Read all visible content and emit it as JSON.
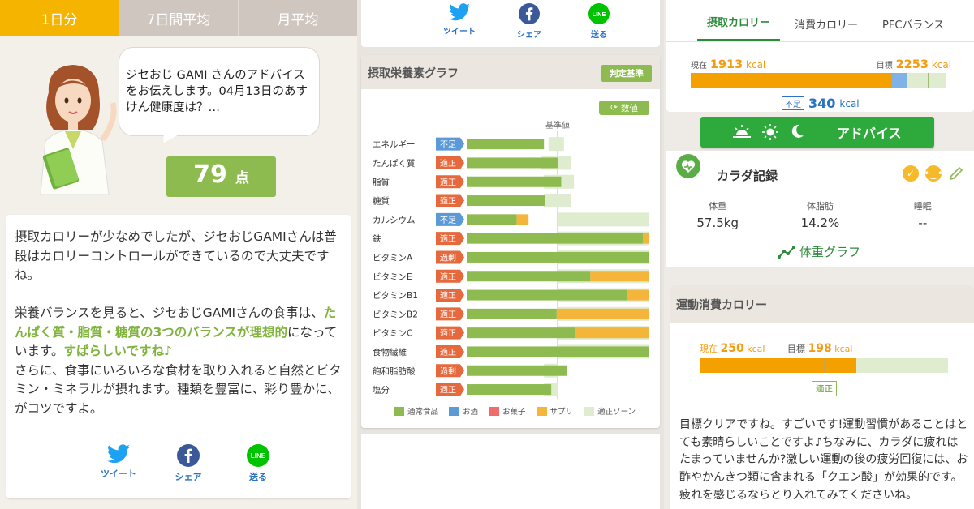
{
  "period_tabs": [
    "1日分",
    "7日間平均",
    "月平均"
  ],
  "bubble_text": "ジセおじ GAMI さんのアドバイスをお伝えします。04月13日のあすけん健康度は？…",
  "score": {
    "value": "79",
    "unit": "点"
  },
  "advice": {
    "p1": "摂取カロリーが少なめでしたが、ジセおじGAMIさんは普段はカロリーコントロールができているので大丈夫ですね。",
    "p2a": "栄養バランスを見ると、ジセおじGAMIさんの食事は、",
    "p2b": "たんぱく質・脂質・糖質の3つのバランスが理想的",
    "p2c": "になっています。",
    "p2d": "すばらしいですね♪",
    "p2e": "さらに、食事にいろいろな食材を取り入れると自然とビタミン・ミネラルが摂れます。種類を豊富に、彩り豊かに、がコツですよ。"
  },
  "share": {
    "tweet": "ツイート",
    "share": "シェア",
    "line": "送る",
    "line_logo": "LINE"
  },
  "nutrition": {
    "title": "摂取栄養素グラフ",
    "criteria_label": "判定基準",
    "value_toggle": "数値",
    "baseline_label": "基準値",
    "legend": [
      {
        "label": "通常食品",
        "color": "#8dbb4f"
      },
      {
        "label": "お酒",
        "color": "#5b9ad6"
      },
      {
        "label": "お菓子",
        "color": "#f06b6b"
      },
      {
        "label": "サプリ",
        "color": "#f5b43a"
      },
      {
        "label": "適正ゾーン",
        "color": "#dfeccf"
      }
    ]
  },
  "chart_data": {
    "type": "bar",
    "categories": [
      "エネルギー",
      "たんぱく質",
      "脂質",
      "糖質",
      "カルシウム",
      "鉄",
      "ビタミンA",
      "ビタミンE",
      "ビタミンB1",
      "ビタミンB2",
      "ビタミンC",
      "食物繊維",
      "飽和脂肪酸",
      "塩分"
    ],
    "judgement": [
      "不足",
      "適正",
      "適正",
      "適正",
      "不足",
      "適正",
      "過剰",
      "適正",
      "適正",
      "適正",
      "適正",
      "適正",
      "過剰",
      "適正"
    ],
    "judgement_colors": {
      "不足": "#5b9ad6",
      "適正": "#e6693e",
      "過剰": "#e6693e"
    },
    "series": [
      {
        "name": "通常食品",
        "values": [
          0.85,
          1.0,
          1.04,
          0.86,
          0.55,
          1.94,
          2.0,
          1.36,
          1.76,
          0.99,
          1.19,
          2.0,
          1.1,
          0.93
        ]
      },
      {
        "name": "サプリ",
        "values": [
          0,
          0,
          0,
          0,
          0.13,
          0.06,
          0,
          0.64,
          0.24,
          1.01,
          0.81,
          0,
          0,
          0
        ]
      }
    ],
    "zone_start": [
      0.9,
      0.82,
      0.85,
      0.85,
      1.0,
      1.0,
      1.0,
      1.0,
      1.0,
      1.0,
      1.0,
      1.0,
      0.85,
      0.85
    ],
    "zone_end": [
      1.07,
      1.15,
      1.18,
      1.15,
      2.0,
      2.0,
      2.0,
      2.0,
      2.0,
      2.0,
      2.0,
      2.0,
      1.0,
      1.0
    ],
    "xlim": [
      0,
      2
    ]
  },
  "calorie_tabs": [
    "摂取カロリー",
    "消費カロリー",
    "PFCバランス"
  ],
  "calorie": {
    "now_label": "現在",
    "now_value": "1913",
    "unit": "kcal",
    "goal_label": "目標",
    "goal_value": "2253",
    "shortage_tag": "不足",
    "shortage_value": "340",
    "fill_ratio": 0.79,
    "goal_ratio": 0.85,
    "zone_mark": 0.93
  },
  "advice_button": "アドバイス",
  "body_record": {
    "title": "カラダ記録",
    "stats": [
      {
        "label": "体重",
        "value": "57.5kg"
      },
      {
        "label": "体脂肪",
        "value": "14.2%"
      },
      {
        "label": "睡眠",
        "value": "--"
      }
    ],
    "graph_link": "体重グラフ"
  },
  "exercise": {
    "title": "運動消費カロリー",
    "now_label": "現在",
    "now_value": "250",
    "unit": "kcal",
    "goal_label": "目標",
    "goal_value": "198",
    "status": "適正",
    "fill_ratio": 0.63,
    "mark_ratio": 0.5,
    "text": "目標クリアですね。すごいです!運動習慣があることはとても素晴らしいことですよ♪ちなみに、カラダに疲れはたまっていませんか?激しい運動の後の疲労回復には、お酢やかんきつ類に含まれる「クエン酸」が効果的です。疲れを感じるならとり入れてみてくださいね。"
  }
}
